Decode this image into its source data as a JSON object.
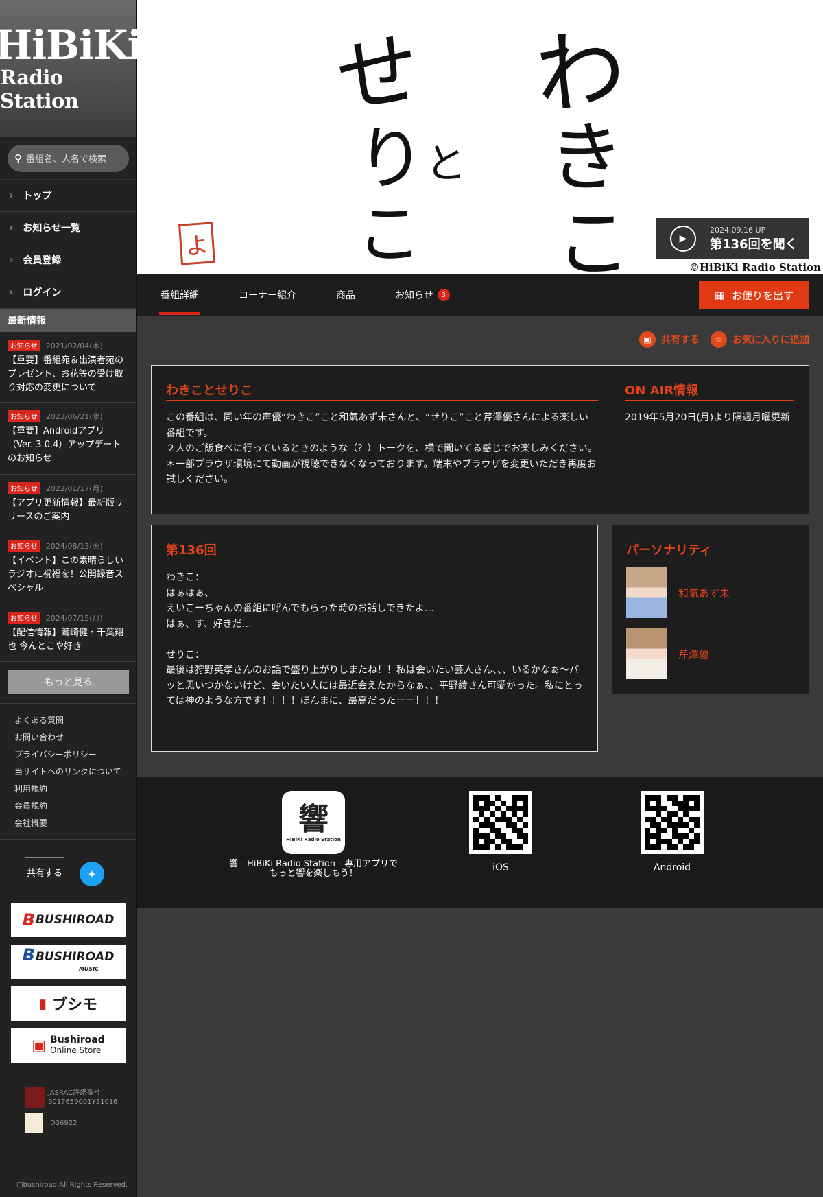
{
  "sidebar": {
    "logo_line1": "HiBiKi",
    "logo_line2": "Radio Station",
    "search_placeholder": "番組名、人名で検索",
    "nav": [
      "トップ",
      "お知らせ一覧",
      "会員登録",
      "ログイン"
    ],
    "news_heading": "最新情報",
    "news": [
      {
        "tag": "お知らせ",
        "date": "2021/02/04(木)",
        "title": "【重要】番組宛＆出演者宛のプレゼント、お花等の受け取り対応の変更について"
      },
      {
        "tag": "お知らせ",
        "date": "2023/06/21(水)",
        "title": "【重要】Androidアプリ（Ver. 3.0.4）アップデートのお知らせ"
      },
      {
        "tag": "お知らせ",
        "date": "2022/01/17(月)",
        "title": "【アプリ更新情報】最新版リリースのご案内"
      },
      {
        "tag": "お知らせ",
        "date": "2024/08/13(火)",
        "title": "【イベント】この素晴らしいラジオに祝福を！公開録音スペシャル"
      },
      {
        "tag": "お知らせ",
        "date": "2024/07/15(月)",
        "title": "【配信情報】鷲崎健・千葉翔也 今んとこや好き"
      }
    ],
    "more_label": "もっと見る",
    "footer_links": [
      "よくある質問",
      "お問い合わせ",
      "プライバシーポリシー",
      "当サイトへのリンクについて",
      "利用規約",
      "会員規約",
      "会社概要"
    ],
    "share_label": "共有する",
    "banners": [
      "BUSHIROAD",
      "BUSHIROAD",
      "ブシモ",
      "Bushiroad"
    ],
    "banner_sub": [
      "",
      "MUSIC",
      "",
      "Online Store"
    ],
    "jasrac_label": "JASRAC許諾番号",
    "jasrac_no": "9017659001Y31016",
    "id_label": "ID36922",
    "copyright": "bushiroad All Rights Reserved."
  },
  "hero": {
    "chars": [
      "わ",
      "き",
      "こ",
      "と",
      "せ",
      "り",
      "こ"
    ],
    "stamp": "よ",
    "listen_date": "2024.09.16 UP",
    "listen_label": "第136回を聞く",
    "copyright": "©HiBiKi Radio Station"
  },
  "tabs": {
    "items": [
      "番組詳細",
      "コーナー紹介",
      "商品",
      "お知らせ"
    ],
    "news_badge": "3",
    "letter_button": "お便りを出す"
  },
  "actions": {
    "share": "共有する",
    "favorite": "お気に入りに追加"
  },
  "program": {
    "title": "わきことせりこ",
    "description": [
      "この番組は、同い年の声優“わきこ”こと和氣あず未さんと、“せりこ”こと芹澤優さんによる楽しい番組です。",
      "２人のご飯食べに行っているときのような（？）トークを、横で聞いてる感じでお楽しみください。",
      "＊一部ブラウザ環境にて動画が視聴できなくなっております。端末やブラウザを変更いただき再度お試しください。"
    ]
  },
  "onair": {
    "title": "ON AIR情報",
    "text": "2019年5月20日(月)より隔週月曜更新"
  },
  "episode": {
    "title": "第136回",
    "lines": [
      "わきこ：",
      "はぁはぁ、",
      "えいこーちゃんの番組に呼んでもらった時のお話しできたよ…",
      "はぁ、す、好きだ…",
      "",
      "せりこ：",
      "最後は狩野英孝さんのお話で盛り上がりしまたね！！私は会いたい芸人さん、、、いるかなぁ〜パッと思いつかないけど、会いたい人には最近会えたからなぁ、、平野綾さん可愛かった。私にとっては神のような方です！！！！ほんまに、最高だったーー！！！"
    ]
  },
  "personality": {
    "title": "パーソナリティ",
    "people": [
      "和氣あず未",
      "芹澤優"
    ]
  },
  "apps": {
    "app_icon_label": "響",
    "app_icon_sub": "HiBiKi Radio Station",
    "app_caption_1": "響 - HiBiKi Radio Station - 専用アプリで",
    "app_caption_2": "もっと響を楽しもう！",
    "ios": " iOS",
    "android": " Android"
  },
  "colors": {
    "accent": "#e0431a",
    "badge": "#d9261c",
    "twitter": "#1da1f2"
  }
}
